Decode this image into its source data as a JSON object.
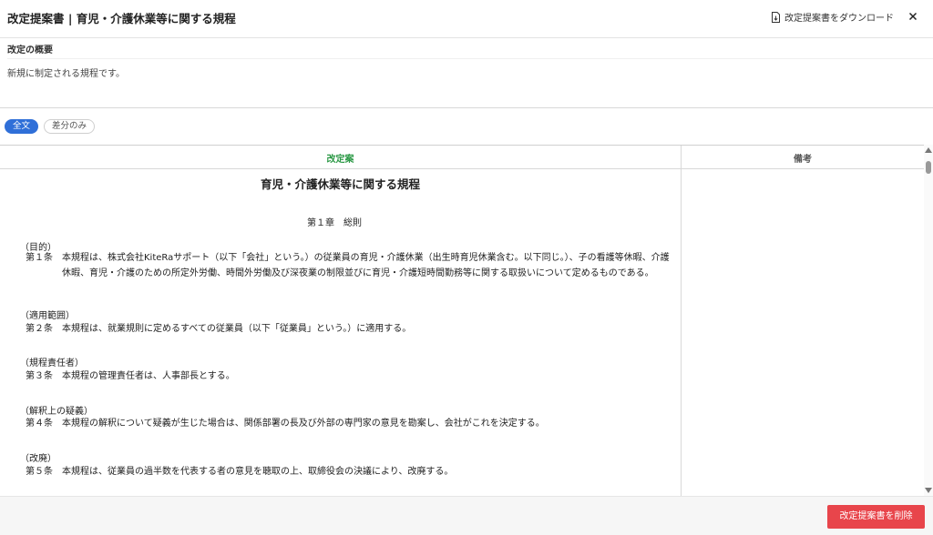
{
  "header": {
    "title": "改定提案書 | 育児・介護休業等に関する規程",
    "download_label": "改定提案書をダウンロード",
    "download_icon": "file-download-icon",
    "close_icon": "close-icon"
  },
  "summary": {
    "heading": "改定の概要",
    "text": "新規に制定される規程です。"
  },
  "view_toggle": {
    "full_label": "全文",
    "diff_label": "差分のみ",
    "selected": "全文"
  },
  "table": {
    "col_draft": "改定案",
    "col_note": "備考"
  },
  "document": {
    "title": "育児・介護休業等に関する規程",
    "chapter_no": "第１章",
    "chapter_name": "総則",
    "sections": [
      {
        "heading": "（目的）",
        "article_no": "第１条",
        "text": "本規程は、株式会社KiteRaサポート（以下「会社」という。）の従業員の育児・介護休業（出生時育児休業含む。以下同じ。）、子の看護等休暇、介護休暇、育児・介護のための所定外労働、時間外労働及び深夜業の制限並びに育児・介護短時間勤務等に関する取扱いについて定めるものである。"
      },
      {
        "heading": "（適用範囲）",
        "article_no": "第２条",
        "text": "本規程は、就業規則に定めるすべての従業員（以下「従業員」という。）に適用する。"
      },
      {
        "heading": "（規程責任者）",
        "article_no": "第３条",
        "text": "本規程の管理責任者は、人事部長とする。"
      },
      {
        "heading": "（解釈上の疑義）",
        "article_no": "第４条",
        "text": "本規程の解釈について疑義が生じた場合は、関係部署の長及び外部の専門家の意見を勘案し、会社がこれを決定する。"
      },
      {
        "heading": "（改廃）",
        "article_no": "第５条",
        "text": "本規程は、従業員の過半数を代表する者の意見を聴取の上、取締役会の決議により、改廃する。"
      }
    ]
  },
  "footer": {
    "delete_label": "改定提案書を削除"
  },
  "colors": {
    "accent_blue": "#2f6fd8",
    "draft_green": "#2e9a48",
    "danger_red": "#e8454b"
  }
}
